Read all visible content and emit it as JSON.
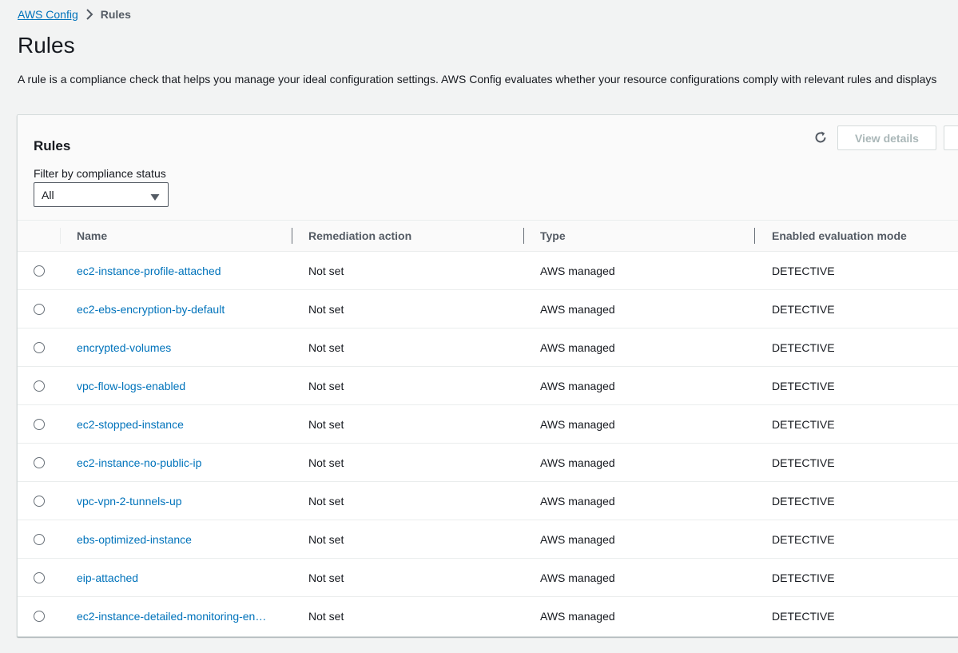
{
  "breadcrumb": {
    "parent": "AWS Config",
    "current": "Rules"
  },
  "page": {
    "title": "Rules",
    "description": "A rule is a compliance check that helps you manage your ideal configuration settings. AWS Config evaluates whether your resource configurations comply with relevant rules and displays"
  },
  "panel": {
    "title": "Rules",
    "view_details_label": "View details",
    "filter_label": "Filter by compliance status",
    "filter_value": "All"
  },
  "table": {
    "columns": [
      "Name",
      "Remediation action",
      "Type",
      "Enabled evaluation mode"
    ],
    "rows": [
      {
        "name": "ec2-instance-profile-attached",
        "remediation": "Not set",
        "type": "AWS managed",
        "mode": "DETECTIVE"
      },
      {
        "name": "ec2-ebs-encryption-by-default",
        "remediation": "Not set",
        "type": "AWS managed",
        "mode": "DETECTIVE"
      },
      {
        "name": "encrypted-volumes",
        "remediation": "Not set",
        "type": "AWS managed",
        "mode": "DETECTIVE"
      },
      {
        "name": "vpc-flow-logs-enabled",
        "remediation": "Not set",
        "type": "AWS managed",
        "mode": "DETECTIVE"
      },
      {
        "name": "ec2-stopped-instance",
        "remediation": "Not set",
        "type": "AWS managed",
        "mode": "DETECTIVE"
      },
      {
        "name": "ec2-instance-no-public-ip",
        "remediation": "Not set",
        "type": "AWS managed",
        "mode": "DETECTIVE"
      },
      {
        "name": "vpc-vpn-2-tunnels-up",
        "remediation": "Not set",
        "type": "AWS managed",
        "mode": "DETECTIVE"
      },
      {
        "name": "ebs-optimized-instance",
        "remediation": "Not set",
        "type": "AWS managed",
        "mode": "DETECTIVE"
      },
      {
        "name": "eip-attached",
        "remediation": "Not set",
        "type": "AWS managed",
        "mode": "DETECTIVE"
      },
      {
        "name": "ec2-instance-detailed-monitoring-en…",
        "remediation": "Not set",
        "type": "AWS managed",
        "mode": "DETECTIVE"
      }
    ]
  },
  "colors": {
    "link": "#0073bb",
    "text": "#16191f",
    "muted": "#545b64",
    "disabled": "#aab7b8",
    "background": "#f2f3f3"
  },
  "icons": {
    "breadcrumb_separator": "chevron-right-icon",
    "refresh": "refresh-icon",
    "dropdown": "caret-down-icon",
    "row_select": "radio-button"
  }
}
